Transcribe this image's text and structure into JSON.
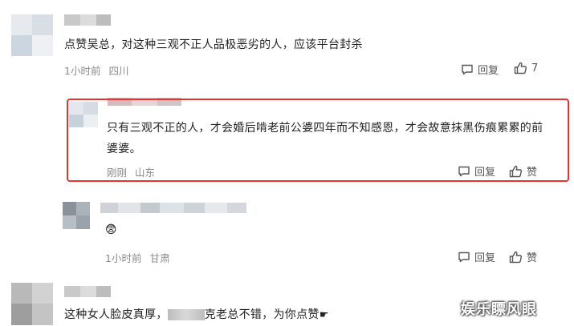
{
  "comments": [
    {
      "text": "点赞吴总，对这种三观不正人品极恶劣的人，应该平台封杀",
      "time": "1小时前",
      "location": "四川",
      "reply_label": "回复",
      "like_label": "7"
    },
    {
      "text": "只有三观不正的人，才会婚后啃老前公婆四年而不知感恩，才会故意抹黑伤痕累累的前婆婆。",
      "time": "刚刚",
      "location": "山东",
      "reply_label": "回复",
      "like_label": "赞"
    },
    {
      "text": "😨",
      "time": "1小时前",
      "location": "甘肃",
      "reply_label": "回复",
      "like_label": "赞"
    },
    {
      "text": "这种女人脸皮真厚，",
      "text_tail": "克老总不错，为你点赞",
      "hand_icon": "☛"
    }
  ],
  "watermark": "娱乐瞟风眼",
  "colors": {
    "highlight": "#e8322c",
    "meta": "#8a8a8a"
  }
}
